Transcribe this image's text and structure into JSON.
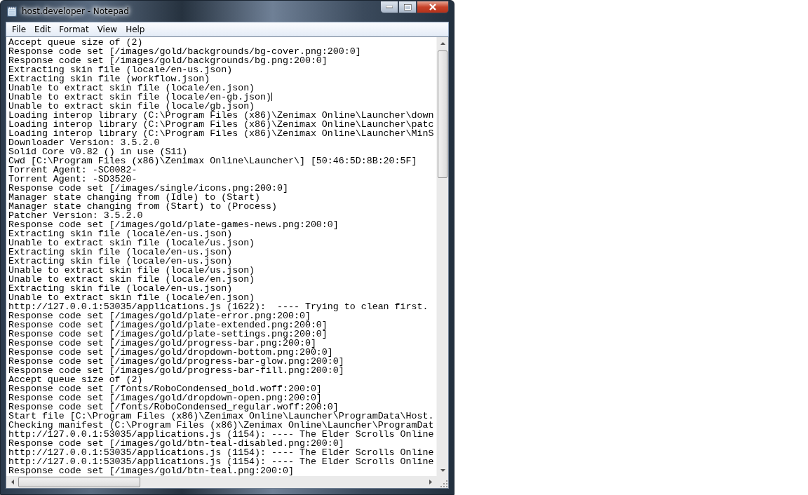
{
  "window": {
    "title": "host.developer - Notepad"
  },
  "menu": [
    "File",
    "Edit",
    "Format",
    "View",
    "Help"
  ],
  "lines": [
    {
      "text": "Accept queue size of (2)",
      "cursor": false
    },
    {
      "text": "Response code set [/images/gold/backgrounds/bg-cover.png:200:0]",
      "cursor": false
    },
    {
      "text": "Response code set [/images/gold/backgrounds/bg.png:200:0]",
      "cursor": false
    },
    {
      "text": "Extracting skin file (locale/en-us.json)",
      "cursor": false
    },
    {
      "text": "Extracting skin file (workflow.json)",
      "cursor": false
    },
    {
      "text": "Unable to extract skin file (locale/en.json)",
      "cursor": false
    },
    {
      "text": "Unable to extract skin file (locale/en-gb.json)",
      "cursor": true
    },
    {
      "text": "Unable to extract skin file (locale/gb.json)",
      "cursor": false
    },
    {
      "text": "Loading interop library (C:\\Program Files (x86)\\Zenimax Online\\Launcher\\down",
      "cursor": false
    },
    {
      "text": "Loading interop library (C:\\Program Files (x86)\\Zenimax Online\\Launcher\\patc",
      "cursor": false
    },
    {
      "text": "Loading interop library (C:\\Program Files (x86)\\Zenimax Online\\Launcher\\MinS",
      "cursor": false
    },
    {
      "text": "Downloader Version: 3.5.2.0",
      "cursor": false
    },
    {
      "text": "Solid Core v0.82 () in use (S11)",
      "cursor": false
    },
    {
      "text": "Cwd [C:\\Program Files (x86)\\Zenimax Online\\Launcher\\] [50:46:5D:8B:20:5F]",
      "cursor": false
    },
    {
      "text": "Torrent Agent: -SC0082-",
      "cursor": false
    },
    {
      "text": "Torrent Agent: -SD3520-",
      "cursor": false
    },
    {
      "text": "Response code set [/images/single/icons.png:200:0]",
      "cursor": false
    },
    {
      "text": "Manager state changing from (Idle) to (Start)",
      "cursor": false
    },
    {
      "text": "Manager state changing from (Start) to (Process)",
      "cursor": false
    },
    {
      "text": "Patcher Version: 3.5.2.0",
      "cursor": false
    },
    {
      "text": "Response code set [/images/gold/plate-games-news.png:200:0]",
      "cursor": false
    },
    {
      "text": "Extracting skin file (locale/en-us.json)",
      "cursor": false
    },
    {
      "text": "Unable to extract skin file (locale/us.json)",
      "cursor": false
    },
    {
      "text": "Extracting skin file (locale/en-us.json)",
      "cursor": false
    },
    {
      "text": "Extracting skin file (locale/en-us.json)",
      "cursor": false
    },
    {
      "text": "Unable to extract skin file (locale/us.json)",
      "cursor": false
    },
    {
      "text": "Unable to extract skin file (locale/en.json)",
      "cursor": false
    },
    {
      "text": "Extracting skin file (locale/en-us.json)",
      "cursor": false
    },
    {
      "text": "Unable to extract skin file (locale/en.json)",
      "cursor": false
    },
    {
      "text": "http://127.0.0.1:53035/applications.js (1622):  ---- Trying to clean first.",
      "cursor": false
    },
    {
      "text": "Response code set [/images/gold/plate-error.png:200:0]",
      "cursor": false
    },
    {
      "text": "Response code set [/images/gold/plate-extended.png:200:0]",
      "cursor": false
    },
    {
      "text": "Response code set [/images/gold/plate-settings.png:200:0]",
      "cursor": false
    },
    {
      "text": "Response code set [/images/gold/progress-bar.png:200:0]",
      "cursor": false
    },
    {
      "text": "Response code set [/images/gold/dropdown-bottom.png:200:0]",
      "cursor": false
    },
    {
      "text": "Response code set [/images/gold/progress-bar-glow.png:200:0]",
      "cursor": false
    },
    {
      "text": "Response code set [/images/gold/progress-bar-fill.png:200:0]",
      "cursor": false
    },
    {
      "text": "Accept queue size of (2)",
      "cursor": false
    },
    {
      "text": "Response code set [/fonts/RoboCondensed_bold.woff:200:0]",
      "cursor": false
    },
    {
      "text": "Response code set [/images/gold/dropdown-open.png:200:0]",
      "cursor": false
    },
    {
      "text": "Response code set [/fonts/RoboCondensed_regular.woff:200:0]",
      "cursor": false
    },
    {
      "text": "Start file [C:\\Program Files (x86)\\Zenimax Online\\Launcher\\ProgramData\\Host.",
      "cursor": false
    },
    {
      "text": "Checking manifest (C:\\Program Files (x86)\\Zenimax Online\\Launcher\\ProgramDat",
      "cursor": false
    },
    {
      "text": "http://127.0.0.1:53035/applications.js (1154): ---- The Elder Scrolls Online",
      "cursor": false
    },
    {
      "text": "Response code set [/images/gold/btn-teal-disabled.png:200:0]",
      "cursor": false
    },
    {
      "text": "http://127.0.0.1:53035/applications.js (1154): ---- The Elder Scrolls Online",
      "cursor": false
    },
    {
      "text": "http://127.0.0.1:53035/applications.js (1154): ---- The Elder Scrolls Online",
      "cursor": false
    },
    {
      "text": "Response code set [/images/gold/btn-teal.png:200:0]",
      "cursor": false
    }
  ]
}
